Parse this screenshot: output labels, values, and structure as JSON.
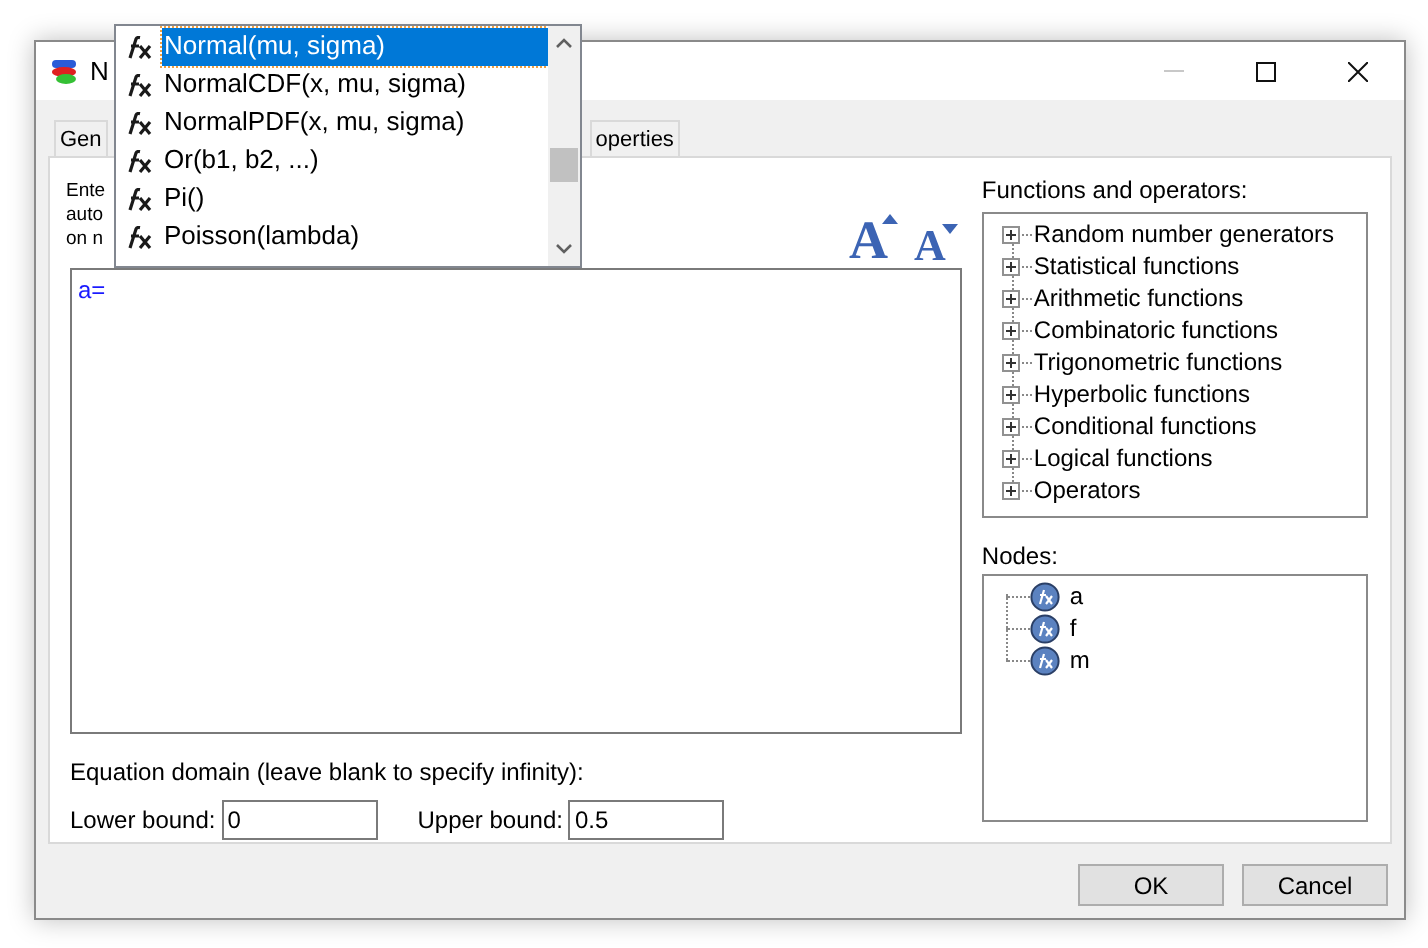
{
  "window": {
    "title": "N",
    "controls": [
      {
        "kind": "minimize",
        "disabled": true
      },
      {
        "kind": "maximize",
        "disabled": false
      },
      {
        "kind": "close",
        "disabled": false
      }
    ]
  },
  "tabs": [
    {
      "label": "Gen"
    },
    {
      "label": "operties"
    }
  ],
  "instructions": [
    "Ente",
    "auto",
    "on n"
  ],
  "font_buttons": [
    {
      "glyph": "A",
      "kind": "increase"
    },
    {
      "glyph": "A",
      "kind": "decrease"
    }
  ],
  "editor": {
    "value": "a="
  },
  "domain": {
    "label": "Equation domain (leave blank to specify infinity):",
    "fields": [
      {
        "label": "Lower bound:",
        "value": "0"
      },
      {
        "label": "Upper bound:",
        "value": "0.5"
      }
    ]
  },
  "functions": {
    "label": "Functions and operators:",
    "items": [
      {
        "label": "Random number generators",
        "expanded": false
      },
      {
        "label": "Statistical functions",
        "expanded": false
      },
      {
        "label": "Arithmetic functions",
        "expanded": false
      },
      {
        "label": "Combinatoric functions",
        "expanded": false
      },
      {
        "label": "Trigonometric functions",
        "expanded": false
      },
      {
        "label": "Hyperbolic functions",
        "expanded": false
      },
      {
        "label": "Conditional functions",
        "expanded": false
      },
      {
        "label": "Logical functions",
        "expanded": false
      },
      {
        "label": "Operators",
        "expanded": false
      }
    ]
  },
  "nodes": {
    "label": "Nodes:",
    "items": [
      {
        "label": "a"
      },
      {
        "label": "f"
      },
      {
        "label": "m"
      }
    ]
  },
  "buttons": [
    "OK",
    "Cancel"
  ],
  "autocomplete": {
    "items": [
      {
        "label": "Normal(mu, sigma)",
        "selected": true
      },
      {
        "label": "NormalCDF(x, mu, sigma)",
        "selected": false
      },
      {
        "label": "NormalPDF(x, mu, sigma)",
        "selected": false
      },
      {
        "label": "Or(b1, b2, ...)",
        "selected": false
      },
      {
        "label": "Pi()",
        "selected": false
      },
      {
        "label": "Poisson(lambda)",
        "selected": false
      }
    ]
  }
}
